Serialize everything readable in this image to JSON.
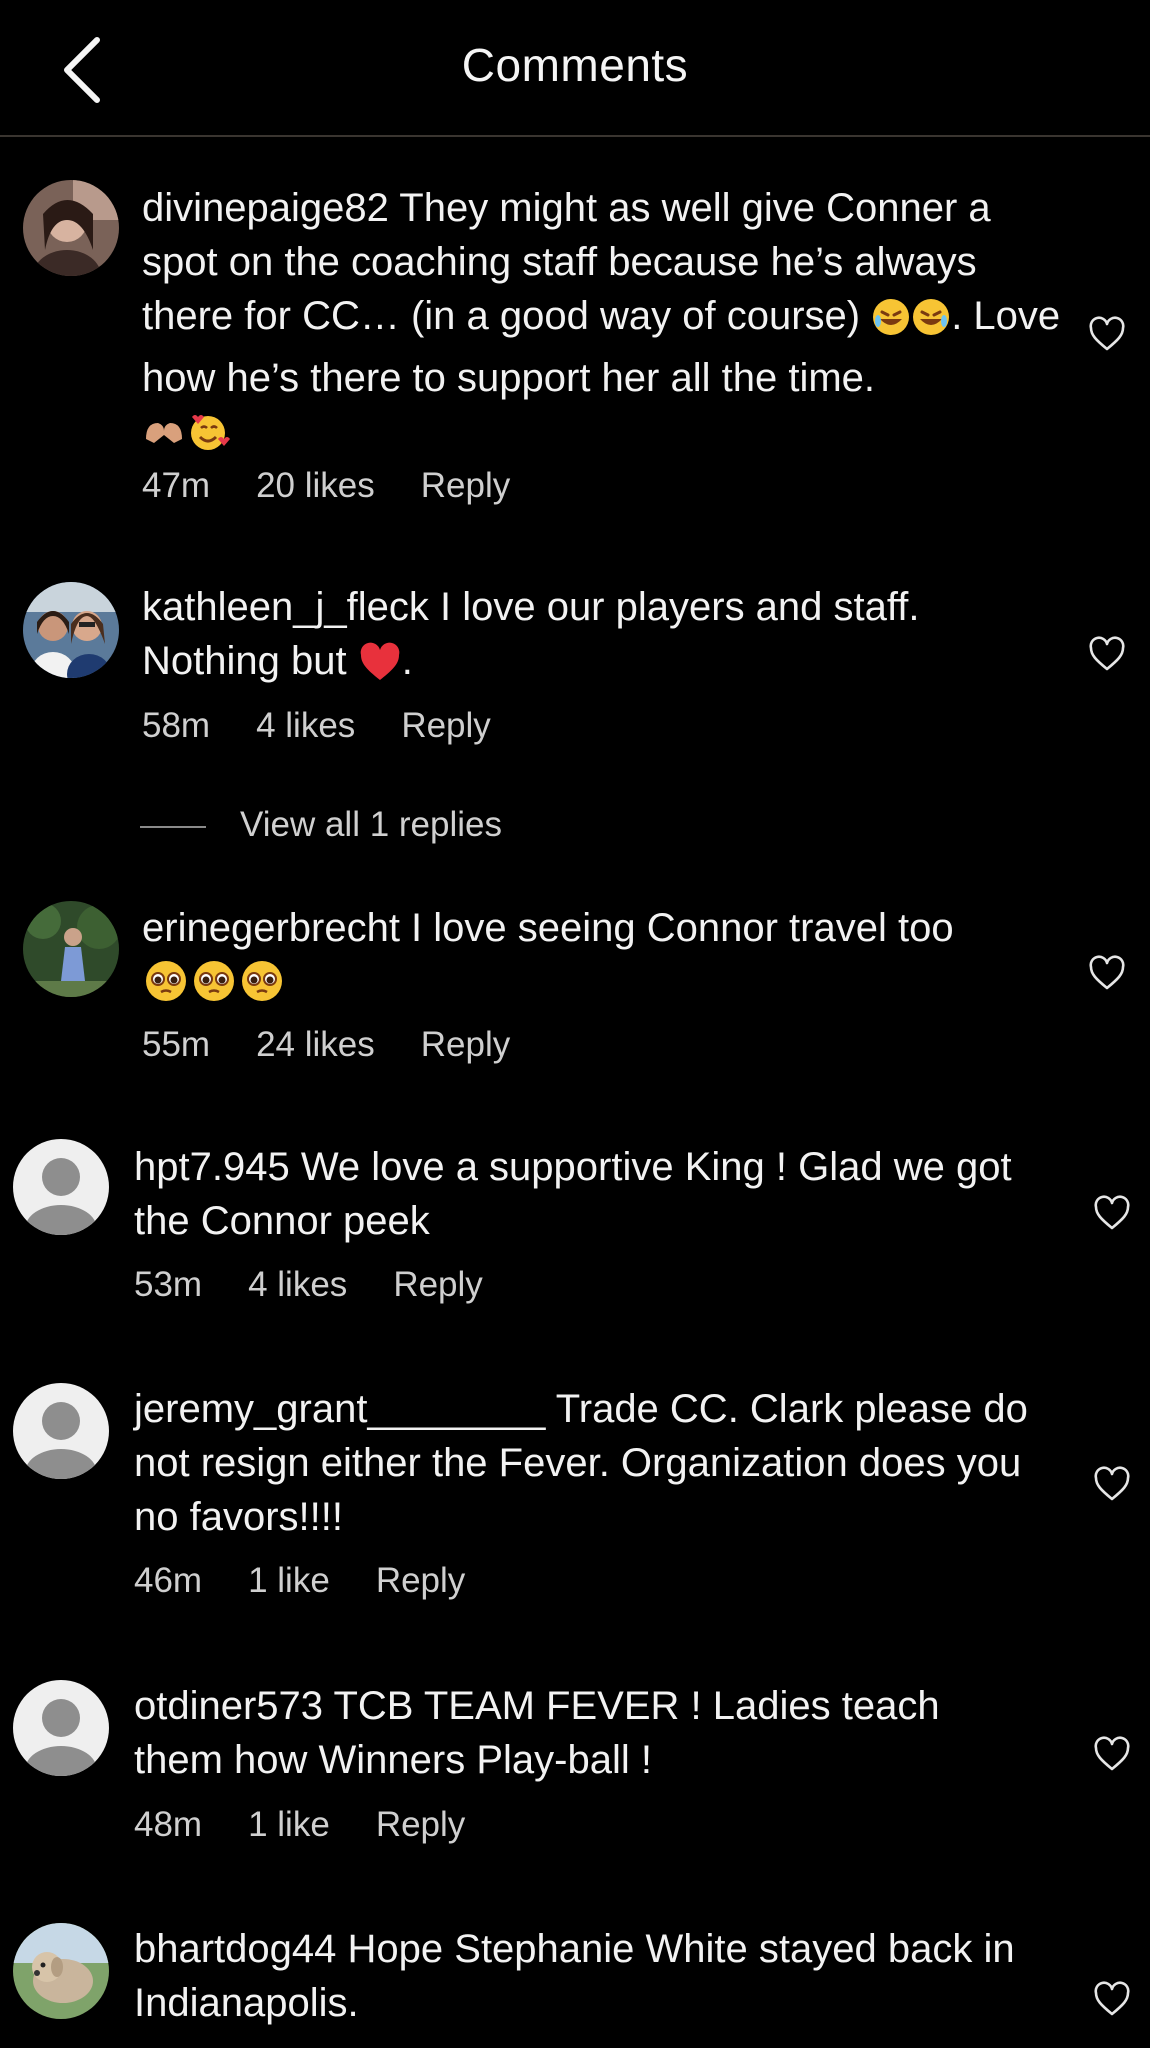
{
  "header": {
    "title": "Comments",
    "back_icon": "chevron-left-icon"
  },
  "comments": [
    {
      "username": "divinepaige82",
      "text": " They might as well give Conner a spot on the coaching staff because he’s always there for CC… (in a good way of course) ",
      "text_after_emoji": ". Love how he’s there to support her all the time.",
      "time": "47m",
      "likes": "20 likes",
      "reply": "Reply"
    },
    {
      "username": "kathleen_j_fleck",
      "text": " I love our players and staff. Nothing but ",
      "text_after_emoji": ".",
      "time": "58m",
      "likes": "4 likes",
      "reply": "Reply",
      "view_replies": "View all 1 replies"
    },
    {
      "username": "erinegerbrecht",
      "text": " I love seeing Connor travel too",
      "time": "55m",
      "likes": "24 likes",
      "reply": "Reply"
    },
    {
      "username": "hpt7.945",
      "text": " We love a supportive King ! Glad we got the Connor peek",
      "time": "53m",
      "likes": "4 likes",
      "reply": "Reply"
    },
    {
      "username": "jeremy_grant________",
      "text": " Trade CC. Clark please do not resign either the Fever. Organization does you no favors!!!!",
      "time": "46m",
      "likes": "1 like",
      "reply": "Reply"
    },
    {
      "username": "otdiner573",
      "text": " TCB TEAM FEVER ! Ladies teach them how Winners Play-ball !",
      "time": "48m",
      "likes": "1 like",
      "reply": "Reply"
    },
    {
      "username": "bhartdog44",
      "text": " Hope Stephanie White stayed back in Indianapolis."
    }
  ],
  "colors": {
    "background": "#000000",
    "text": "#f2f2f2",
    "meta_text": "#cfcfcf",
    "divider": "#3a3530"
  }
}
